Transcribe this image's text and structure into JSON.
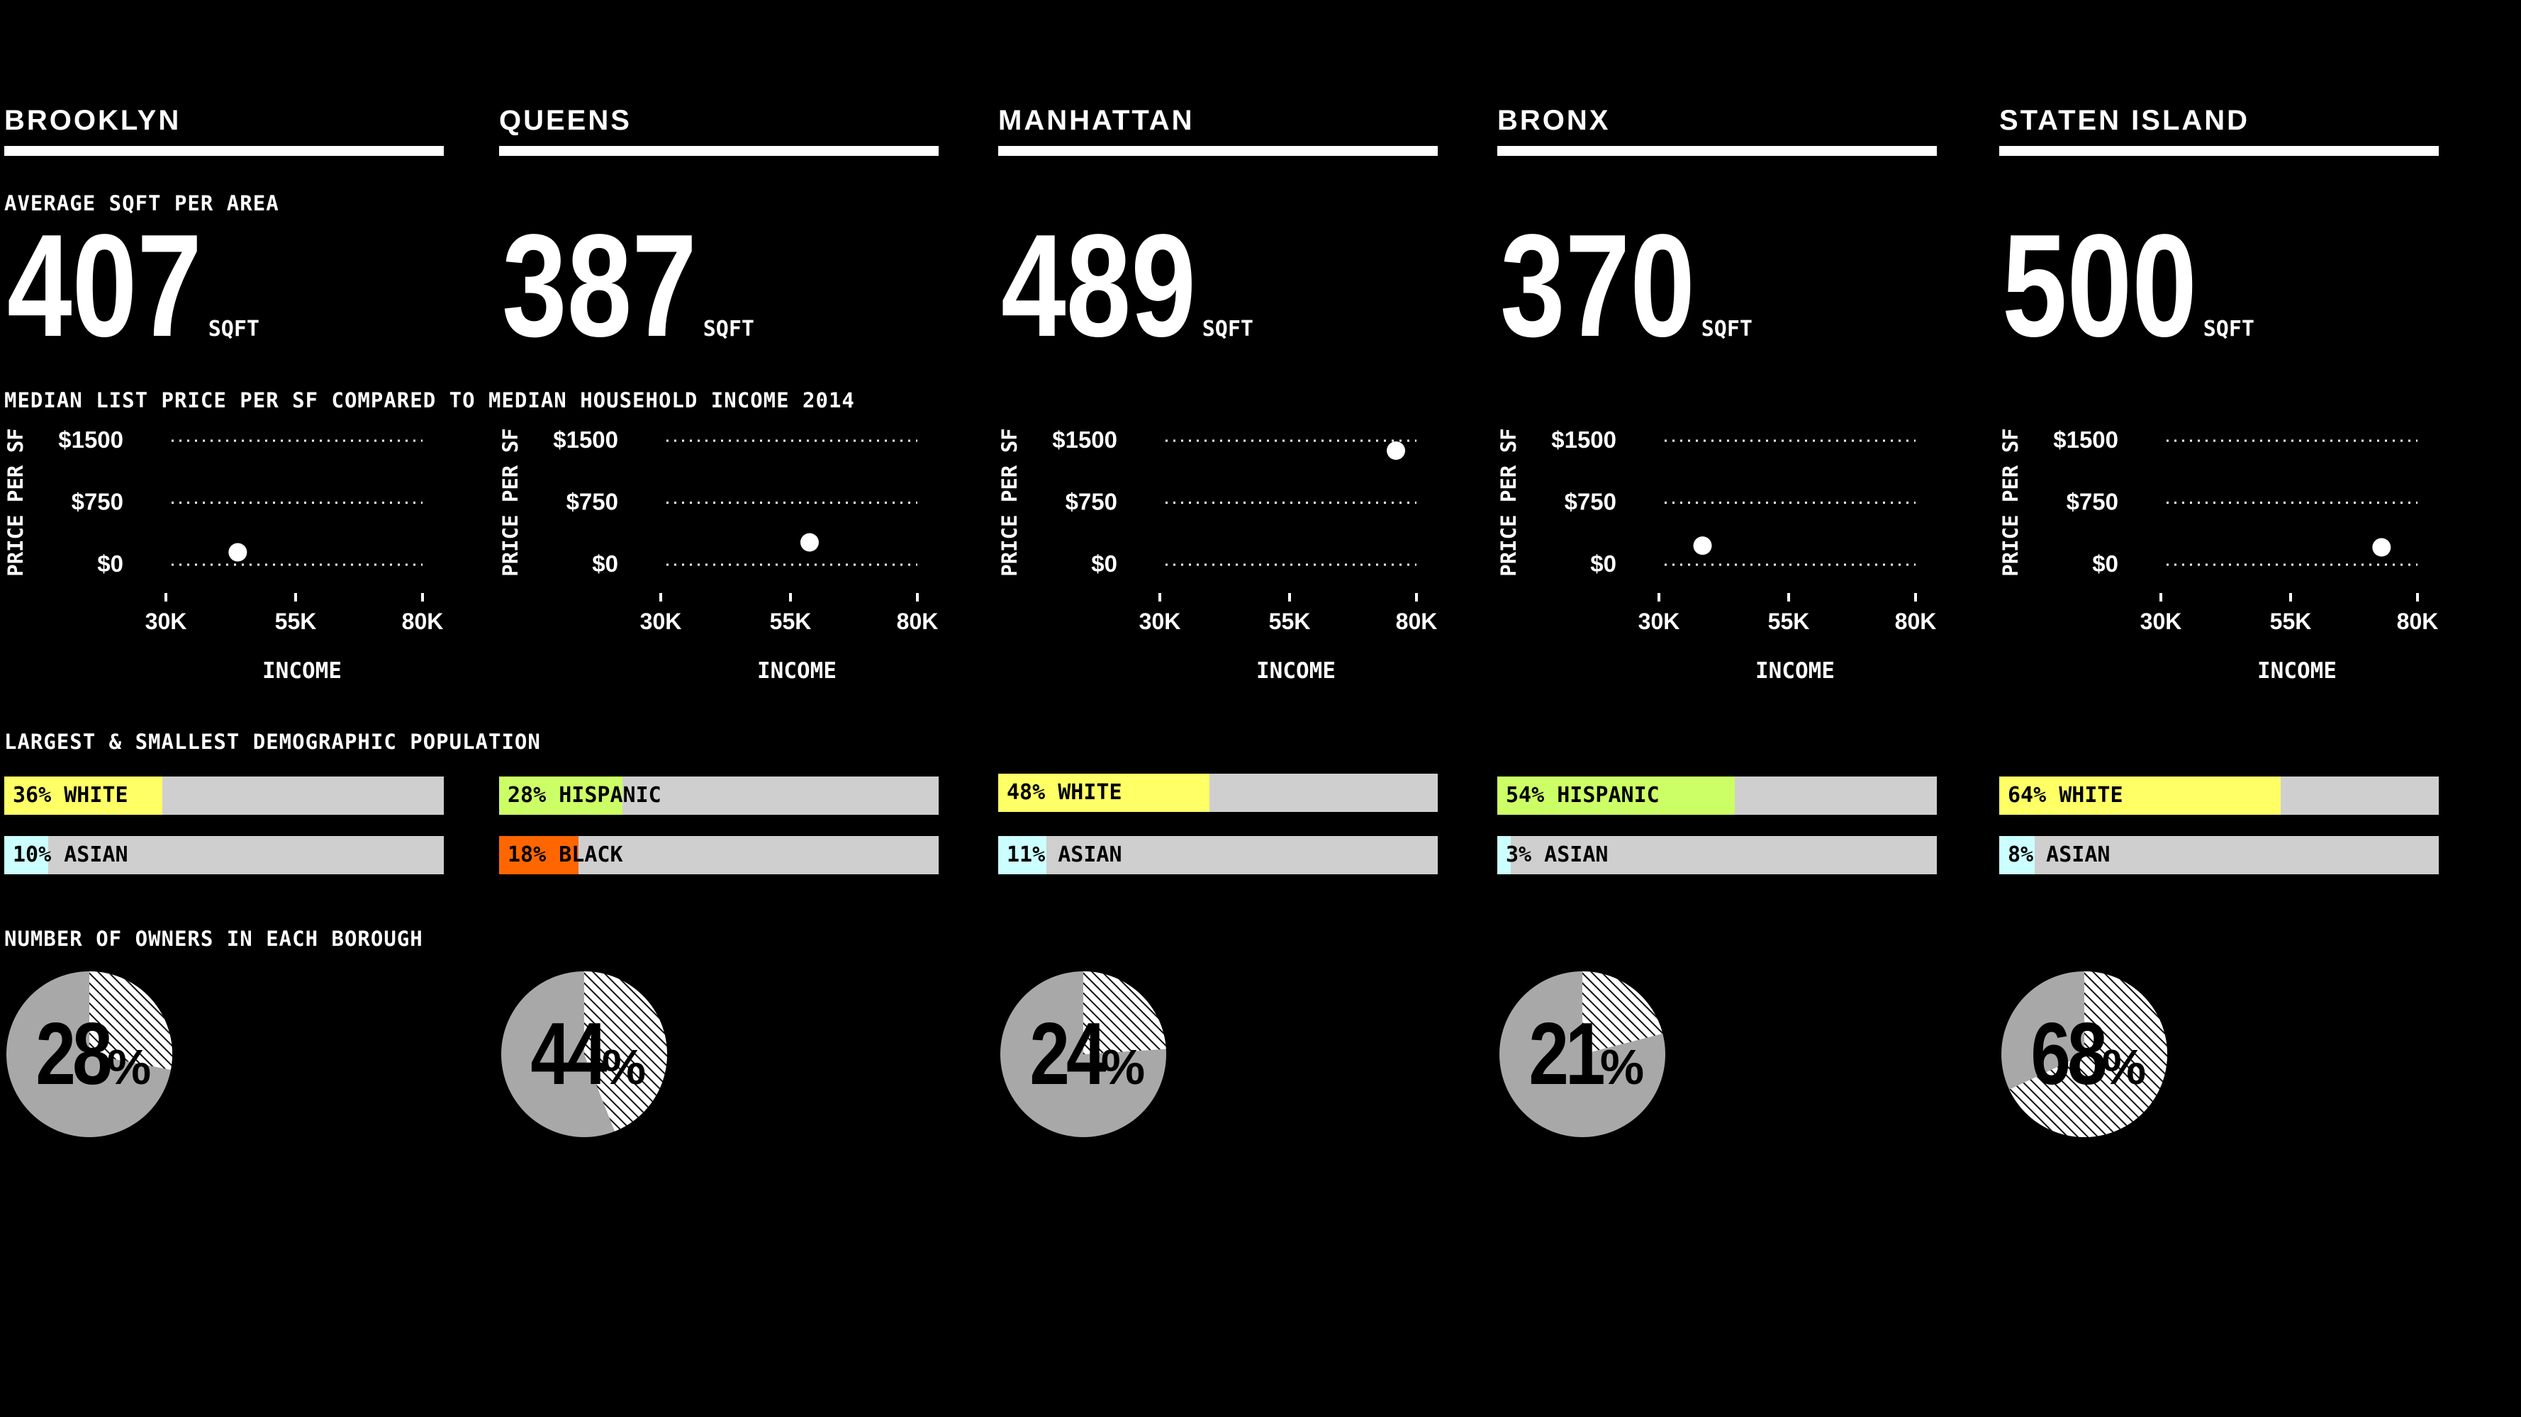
{
  "labels": {
    "avg_sqft": "AVERAGE SQFT PER AREA",
    "price_vs_income": "MEDIAN LIST PRICE PER SF COMPARED TO MEDIAN HOUSEHOLD INCOME 2014",
    "demographics": "LARGEST & SMALLEST DEMOGRAPHIC POPULATION",
    "owners": "NUMBER OF OWNERS IN EACH BOROUGH",
    "sqft_unit": "SQFT",
    "percent_sign": "%"
  },
  "colors": {
    "background": "#000000",
    "text": "#ffffff",
    "bar_track": "#cfcfcf",
    "pie_fill": "#a8a8a8",
    "yellow": "#ffff66",
    "lime": "#ccff66",
    "cyan": "#ccffff",
    "orange": "#ff6600"
  },
  "boroughs": [
    {
      "name": "BROOKLYN",
      "sqft": "407",
      "largest": {
        "text": "36% WHITE",
        "pct": 36,
        "color": "#ffff66"
      },
      "smallest": {
        "text": "10% ASIAN",
        "pct": 10,
        "color": "#ccffff"
      },
      "owners": {
        "value": "28",
        "pct": 28
      }
    },
    {
      "name": "QUEENS",
      "sqft": "387",
      "largest": {
        "text": "28% HISPANIC",
        "pct": 28,
        "color": "#ccff66"
      },
      "smallest": {
        "text": "18% BLACK",
        "pct": 18,
        "color": "#ff6600"
      },
      "owners": {
        "value": "44",
        "pct": 44
      }
    },
    {
      "name": "MANHATTAN",
      "sqft": "489",
      "largest": {
        "text": "48% WHITE",
        "pct": 48,
        "color": "#ffff66"
      },
      "smallest": {
        "text": "11% ASIAN",
        "pct": 11,
        "color": "#ccffff"
      },
      "owners": {
        "value": "24",
        "pct": 24
      }
    },
    {
      "name": "BRONX",
      "sqft": "370",
      "largest": {
        "text": "54% HISPANIC",
        "pct": 54,
        "color": "#ccff66"
      },
      "smallest": {
        "text": "3% ASIAN",
        "pct": 3,
        "color": "#ccffff"
      },
      "owners": {
        "value": "21",
        "pct": 21
      }
    },
    {
      "name": "STATEN ISLAND",
      "sqft": "500",
      "largest": {
        "text": "64% WHITE",
        "pct": 64,
        "color": "#ffff66"
      },
      "smallest": {
        "text": "8% ASIAN",
        "pct": 8,
        "color": "#ccffff"
      },
      "owners": {
        "value": "68",
        "pct": 68
      }
    }
  ],
  "chart_data": [
    {
      "type": "scatter",
      "title": "BROOKLYN",
      "xlabel": "INCOME",
      "ylabel": "PRICE PER SF",
      "x_ticks": [
        "30K",
        "55K",
        "80K"
      ],
      "y_ticks": [
        "$1500",
        "$750",
        "$0"
      ],
      "xlim": [
        30000,
        80000
      ],
      "ylim": [
        0,
        1500
      ],
      "grid": true,
      "points": [
        {
          "x": 44000,
          "y": 150
        }
      ]
    },
    {
      "type": "scatter",
      "title": "QUEENS",
      "xlabel": "INCOME",
      "ylabel": "PRICE PER SF",
      "x_ticks": [
        "30K",
        "55K",
        "80K"
      ],
      "y_ticks": [
        "$1500",
        "$750",
        "$0"
      ],
      "xlim": [
        30000,
        80000
      ],
      "ylim": [
        0,
        1500
      ],
      "grid": true,
      "points": [
        {
          "x": 59000,
          "y": 270
        }
      ]
    },
    {
      "type": "scatter",
      "title": "MANHATTAN",
      "xlabel": "INCOME",
      "ylabel": "PRICE PER SF",
      "x_ticks": [
        "30K",
        "55K",
        "80K"
      ],
      "y_ticks": [
        "$1500",
        "$750",
        "$0"
      ],
      "xlim": [
        30000,
        80000
      ],
      "ylim": [
        0,
        1500
      ],
      "grid": true,
      "points": [
        {
          "x": 76000,
          "y": 1380
        }
      ]
    },
    {
      "type": "scatter",
      "title": "BRONX",
      "xlabel": "INCOME",
      "ylabel": "PRICE PER SF",
      "x_ticks": [
        "30K",
        "55K",
        "80K"
      ],
      "y_ticks": [
        "$1500",
        "$750",
        "$0"
      ],
      "xlim": [
        30000,
        80000
      ],
      "ylim": [
        0,
        1500
      ],
      "grid": true,
      "points": [
        {
          "x": 38500,
          "y": 230
        }
      ]
    },
    {
      "type": "scatter",
      "title": "STATEN ISLAND",
      "xlabel": "INCOME",
      "ylabel": "PRICE PER SF",
      "x_ticks": [
        "30K",
        "55K",
        "80K"
      ],
      "y_ticks": [
        "$1500",
        "$750",
        "$0"
      ],
      "xlim": [
        30000,
        80000
      ],
      "ylim": [
        0,
        1500
      ],
      "grid": true,
      "points": [
        {
          "x": 73000,
          "y": 210
        }
      ]
    }
  ]
}
